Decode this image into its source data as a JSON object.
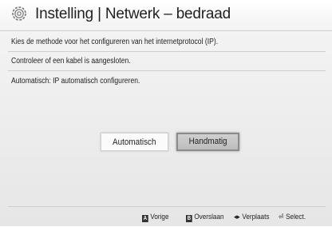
{
  "header": {
    "title": "Instelling | Netwerk – bedraad",
    "icon": "gear-icon"
  },
  "body": {
    "instruction": "Kies de methode voor het configureren van het internetprotocol (IP).",
    "cable_check": "Controleer of een kabel is aangesloten.",
    "description": "Automatisch: IP automatisch configureren."
  },
  "buttons": {
    "auto_label": "Automatisch",
    "manual_label": "Handmatig"
  },
  "footer": {
    "back_key": "A",
    "back_label": "Vorige",
    "skip_key": "B",
    "skip_label": "Overslaan",
    "move_glyph": "◂▸",
    "move_label": "Verplaats",
    "select_glyph": "⏎",
    "select_label": "Select."
  }
}
